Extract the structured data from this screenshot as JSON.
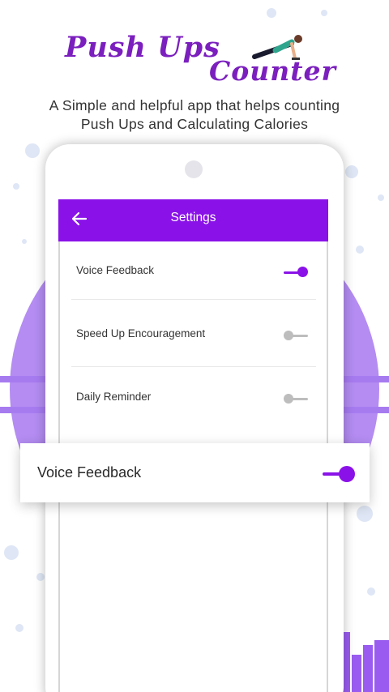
{
  "header": {
    "title_line1": "Push Ups",
    "title_line2": "Counter",
    "tagline_line1": "A Simple and helpful app that helps counting",
    "tagline_line2": "Push Ups and Calculating Calories"
  },
  "appbar": {
    "back_icon": "arrow-left-icon",
    "title": "Settings"
  },
  "settings": [
    {
      "label": "Voice Feedback",
      "enabled": true
    },
    {
      "label": "Speed Up Encouragement",
      "enabled": false
    },
    {
      "label": "Daily Reminder",
      "enabled": false
    }
  ],
  "highlight_card": {
    "label": "Voice Feedback",
    "enabled": true
  },
  "colors": {
    "primary": "#8a12e8",
    "title": "#7b1fbe",
    "accent_light": "#b98ff0",
    "toggle_off": "#bdbdbd"
  }
}
